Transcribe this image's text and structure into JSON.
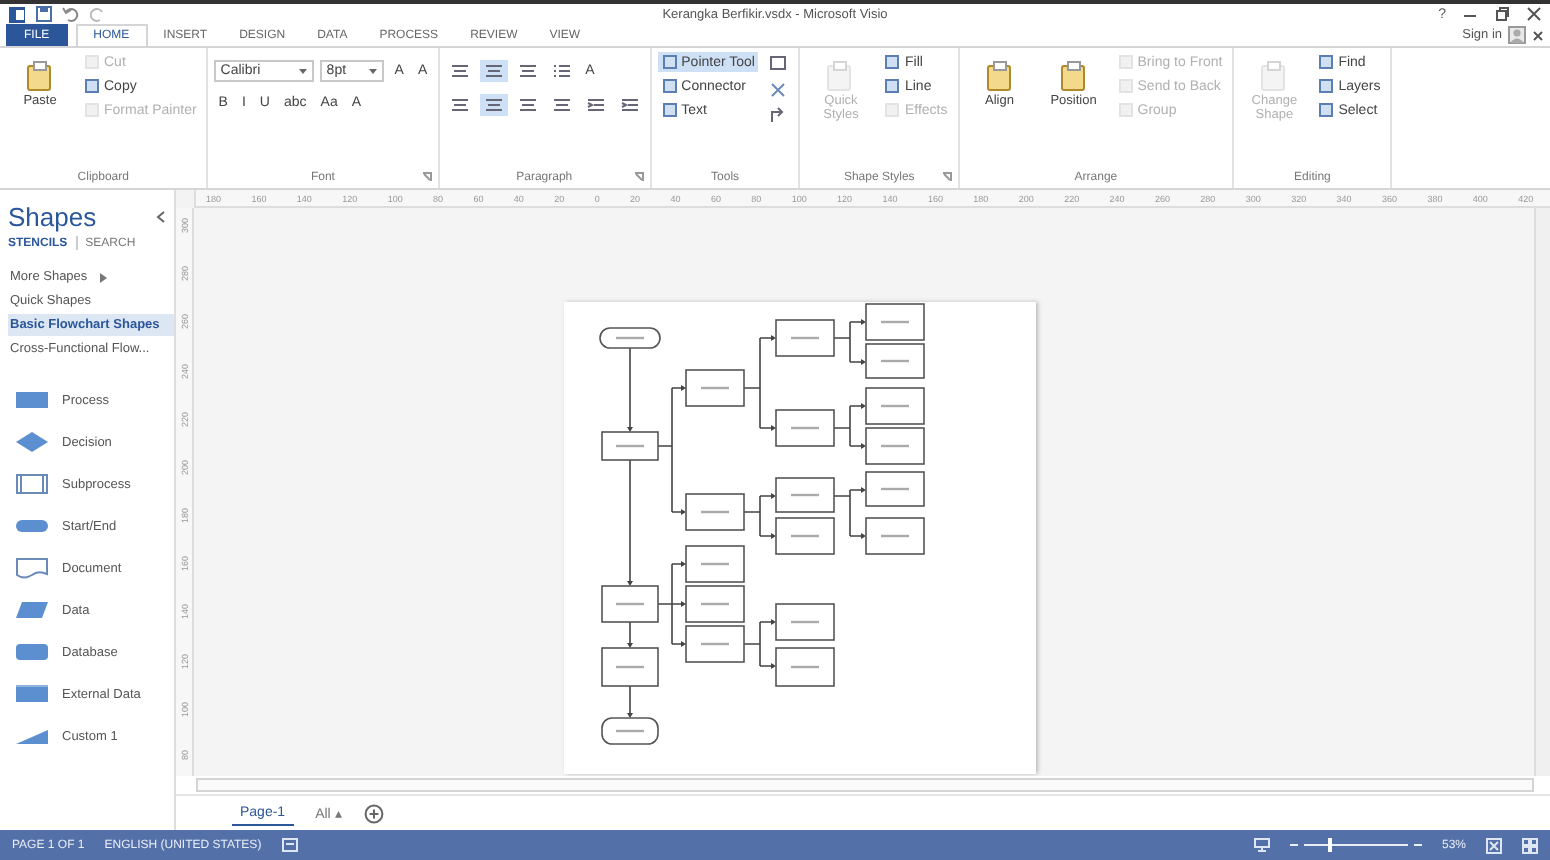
{
  "window": {
    "title": "Kerangka Berfikir.vsdx - Microsoft Visio",
    "help": "?"
  },
  "tabs": [
    {
      "label": "FILE",
      "kind": "file",
      "selected": false
    },
    {
      "label": "HOME",
      "kind": "tab",
      "selected": true
    },
    {
      "label": "INSERT",
      "kind": "tab",
      "selected": false
    },
    {
      "label": "DESIGN",
      "kind": "tab",
      "selected": false
    },
    {
      "label": "DATA",
      "kind": "tab",
      "selected": false
    },
    {
      "label": "PROCESS",
      "kind": "tab",
      "selected": false
    },
    {
      "label": "REVIEW",
      "kind": "tab",
      "selected": false
    },
    {
      "label": "VIEW",
      "kind": "tab",
      "selected": false
    }
  ],
  "account": {
    "label": "Sign in"
  },
  "ribbon": {
    "groups": [
      {
        "label": "Clipboard",
        "stacks": [
          [
            {
              "kind": "large",
              "label": "Paste",
              "disabled": false,
              "selected": false
            }
          ],
          [
            {
              "kind": "small",
              "label": "Cut",
              "disabled": true,
              "selected": false
            },
            {
              "kind": "small",
              "label": "Copy",
              "disabled": false,
              "selected": false
            },
            {
              "kind": "small",
              "label": "Format Painter",
              "disabled": true,
              "selected": false
            }
          ]
        ]
      },
      {
        "label": "Font",
        "launcher": true,
        "bands": [
          [
            {
              "kind": "combo",
              "label": "Calibri",
              "disabled": false,
              "selected": false
            },
            {
              "kind": "combo",
              "label": "8pt",
              "disabled": false,
              "selected": false
            },
            {
              "kind": "glyph",
              "label": "A",
              "disabled": false,
              "selected": false
            },
            {
              "kind": "glyph",
              "label": "A",
              "disabled": false,
              "selected": false
            }
          ],
          [
            {
              "kind": "glyph",
              "label": "B",
              "disabled": false,
              "selected": false
            },
            {
              "kind": "glyph",
              "label": "I",
              "disabled": false,
              "selected": false
            },
            {
              "kind": "glyph",
              "label": "U",
              "disabled": false,
              "selected": false
            },
            {
              "kind": "glyph",
              "label": "abc",
              "disabled": false,
              "selected": false
            },
            {
              "kind": "glyph",
              "label": "Aa",
              "disabled": false,
              "selected": false
            },
            {
              "kind": "glyph",
              "label": "A",
              "disabled": false,
              "selected": false
            }
          ]
        ]
      },
      {
        "label": "Paragraph",
        "launcher": true,
        "bands": [
          [
            {
              "kind": "align",
              "disabled": false,
              "selected": false
            },
            {
              "kind": "align",
              "disabled": false,
              "selected": true
            },
            {
              "kind": "align",
              "disabled": false,
              "selected": false
            },
            {
              "kind": "bullets",
              "disabled": false,
              "selected": false
            },
            {
              "kind": "glyph",
              "label": "A",
              "disabled": false,
              "selected": false
            }
          ],
          [
            {
              "kind": "align",
              "disabled": false,
              "selected": false
            },
            {
              "kind": "align",
              "disabled": false,
              "selected": true
            },
            {
              "kind": "align",
              "disabled": false,
              "selected": false
            },
            {
              "kind": "align",
              "disabled": false,
              "selected": false
            },
            {
              "kind": "indent",
              "disabled": false,
              "selected": false
            },
            {
              "kind": "indent",
              "disabled": false,
              "selected": false
            }
          ]
        ]
      },
      {
        "label": "Tools",
        "stacks": [
          [
            {
              "kind": "small",
              "label": "Pointer Tool",
              "disabled": false,
              "selected": true
            },
            {
              "kind": "small",
              "label": "Connector",
              "disabled": false,
              "selected": false
            },
            {
              "kind": "small",
              "label": "Text",
              "disabled": false,
              "selected": false
            }
          ],
          [
            {
              "kind": "rect",
              "disabled": false,
              "selected": false
            },
            {
              "kind": "cross",
              "disabled": false,
              "selected": false
            },
            {
              "kind": "rotate",
              "disabled": false,
              "selected": false
            }
          ]
        ]
      },
      {
        "label": "Shape Styles",
        "launcher": true,
        "stacks": [
          [
            {
              "kind": "large",
              "label": "Quick Styles",
              "disabled": true,
              "selected": false
            }
          ],
          [
            {
              "kind": "small",
              "label": "Fill",
              "disabled": false,
              "selected": false
            },
            {
              "kind": "small",
              "label": "Line",
              "disabled": false,
              "selected": false
            },
            {
              "kind": "small",
              "label": "Effects",
              "disabled": true,
              "selected": false
            }
          ]
        ]
      },
      {
        "label": "Arrange",
        "stacks": [
          [
            {
              "kind": "large",
              "label": "Align",
              "disabled": false,
              "selected": false
            }
          ],
          [
            {
              "kind": "large",
              "label": "Position",
              "disabled": false,
              "selected": false
            }
          ],
          [
            {
              "kind": "small",
              "label": "Bring to Front",
              "disabled": true,
              "selected": false
            },
            {
              "kind": "small",
              "label": "Send to Back",
              "disabled": true,
              "selected": false
            },
            {
              "kind": "small",
              "label": "Group",
              "disabled": true,
              "selected": false
            }
          ]
        ]
      },
      {
        "label": "Editing",
        "stacks": [
          [
            {
              "kind": "large",
              "label": "Change Shape",
              "disabled": true,
              "selected": false
            }
          ],
          [
            {
              "kind": "small",
              "label": "Find",
              "disabled": false,
              "selected": false
            },
            {
              "kind": "small",
              "label": "Layers",
              "disabled": false,
              "selected": false
            },
            {
              "kind": "small",
              "label": "Select",
              "disabled": false,
              "selected": false
            }
          ]
        ]
      }
    ]
  },
  "sidebar": {
    "title": "Shapes",
    "tabs": [
      {
        "label": "STENCILS",
        "selected": true
      },
      {
        "label": "SEARCH",
        "selected": false
      }
    ],
    "items": [
      {
        "label": "More Shapes",
        "selected": false,
        "kind": "menu"
      },
      {
        "label": "Quick Shapes",
        "selected": false,
        "kind": "link"
      },
      {
        "label": "Basic Flowchart Shapes",
        "selected": true,
        "kind": "link"
      },
      {
        "label": "Cross-Functional Flow...",
        "selected": false,
        "kind": "link"
      }
    ],
    "shapes": [
      {
        "label": "Process",
        "kind": "process"
      },
      {
        "label": "Decision",
        "kind": "decision"
      },
      {
        "label": "Subprocess",
        "kind": "subprocess"
      },
      {
        "label": "Start/End",
        "kind": "terminator"
      },
      {
        "label": "Document",
        "kind": "document"
      },
      {
        "label": "Data",
        "kind": "data"
      },
      {
        "label": "Database",
        "kind": "database"
      },
      {
        "label": "External Data",
        "kind": "external"
      },
      {
        "label": "Custom 1",
        "kind": "custom"
      }
    ]
  },
  "rulers": {
    "horizontal": [
      "180",
      "160",
      "140",
      "120",
      "100",
      "80",
      "60",
      "40",
      "20",
      "0",
      "20",
      "40",
      "60",
      "80",
      "100",
      "120",
      "140",
      "160",
      "180",
      "200",
      "220",
      "240",
      "260",
      "280",
      "300",
      "320",
      "340",
      "360",
      "380",
      "400",
      "420"
    ],
    "vertical": [
      "300",
      "280",
      "260",
      "240",
      "220",
      "200",
      "180",
      "160",
      "140",
      "120",
      "100",
      "80"
    ]
  },
  "page_tabs": [
    {
      "label": "Page-1",
      "kind": "page",
      "selected": true
    },
    {
      "label": "All ▴",
      "kind": "all",
      "selected": false
    }
  ],
  "status_bar": {
    "page": "PAGE 1 OF 1",
    "language": "ENGLISH (UNITED STATES)",
    "zoom": {
      "level": 0.25,
      "reading": "53%"
    }
  }
}
